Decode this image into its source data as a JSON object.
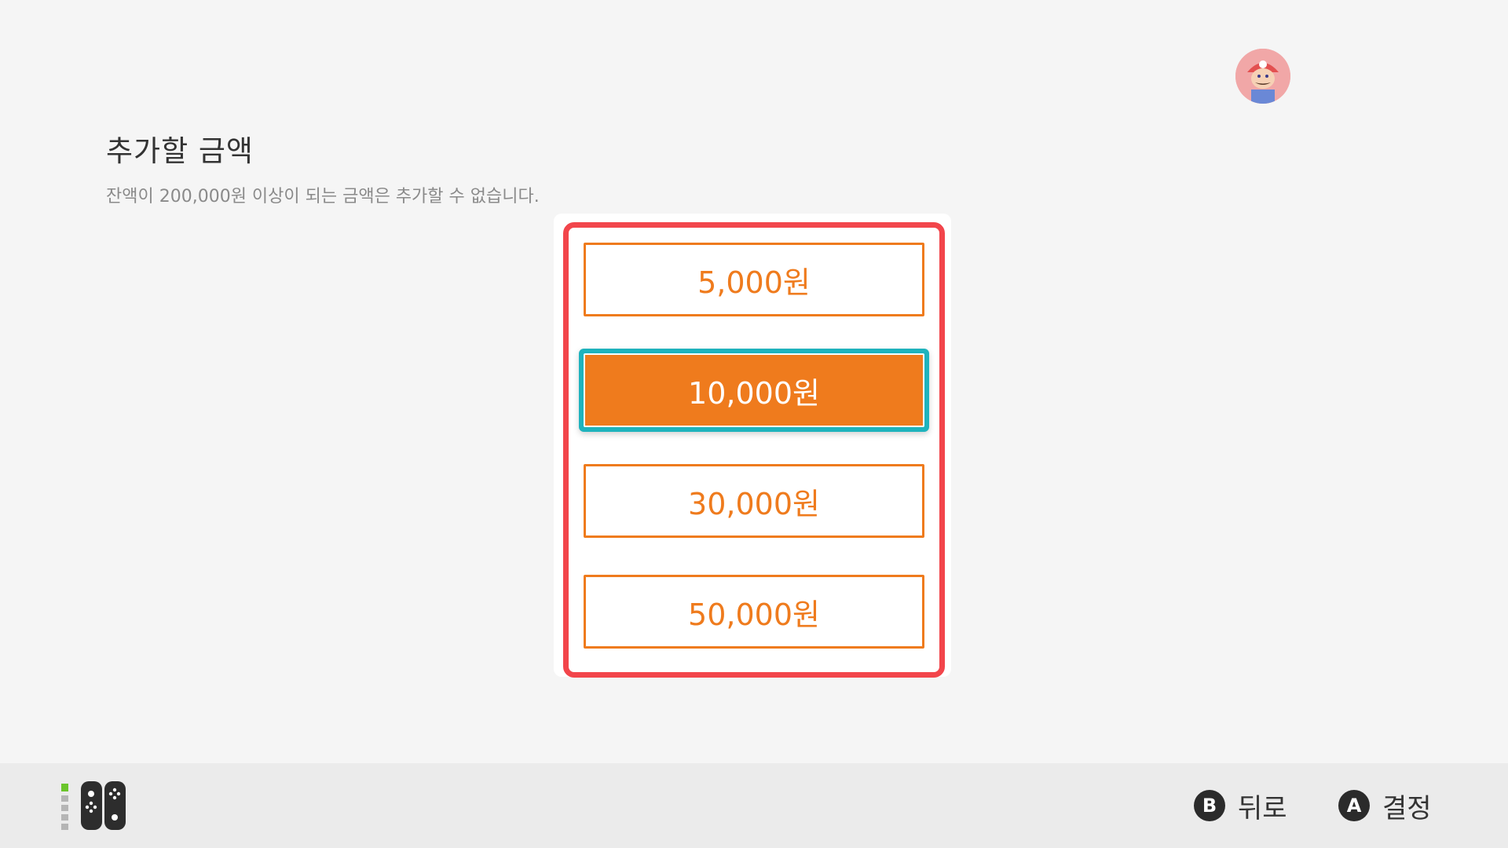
{
  "header": {
    "avatar_icon": "mario-avatar-icon"
  },
  "page": {
    "title": "추가할 금액",
    "subtitle": "잔액이 200,000원 이상이 되는 금액은 추가할 수 없습니다."
  },
  "amounts": [
    {
      "label": "5,000원",
      "selected": false
    },
    {
      "label": "10,000원",
      "selected": true
    },
    {
      "label": "30,000원",
      "selected": false
    },
    {
      "label": "50,000원",
      "selected": false
    }
  ],
  "footer": {
    "controller_icon": "joy-con-icon",
    "back": {
      "button": "B",
      "label": "뒤로"
    },
    "confirm": {
      "button": "A",
      "label": "결정"
    }
  },
  "colors": {
    "accent": "#ef7b1d",
    "focus": "#1fb3bd",
    "annotation_frame": "#f2454b",
    "background": "#f5f5f5"
  }
}
